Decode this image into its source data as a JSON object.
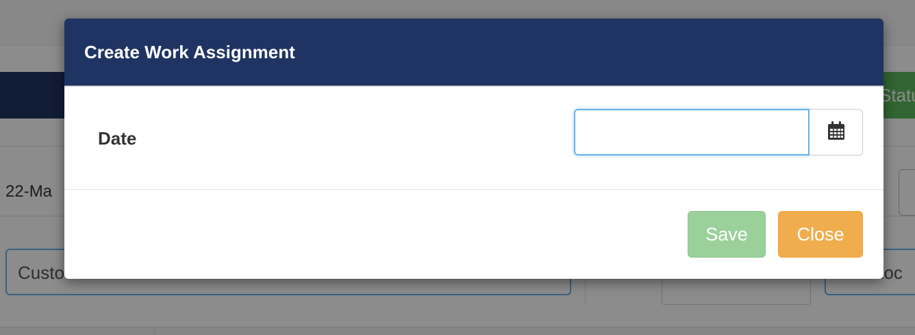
{
  "background": {
    "status_button_label": "Statu",
    "row_date_text": "22-Ma",
    "customer_input_text": "Custo",
    "location_input_text": "Loc"
  },
  "modal": {
    "title": "Create Work Assignment",
    "date_label": "Date",
    "date_value": "",
    "calendar_icon": "calendar-icon",
    "buttons": {
      "save_label": "Save",
      "close_label": "Close"
    }
  },
  "colors": {
    "header": "#1f3462",
    "save": "#9bd09b",
    "close": "#f0ad4e",
    "focus_border": "#66afe9"
  }
}
